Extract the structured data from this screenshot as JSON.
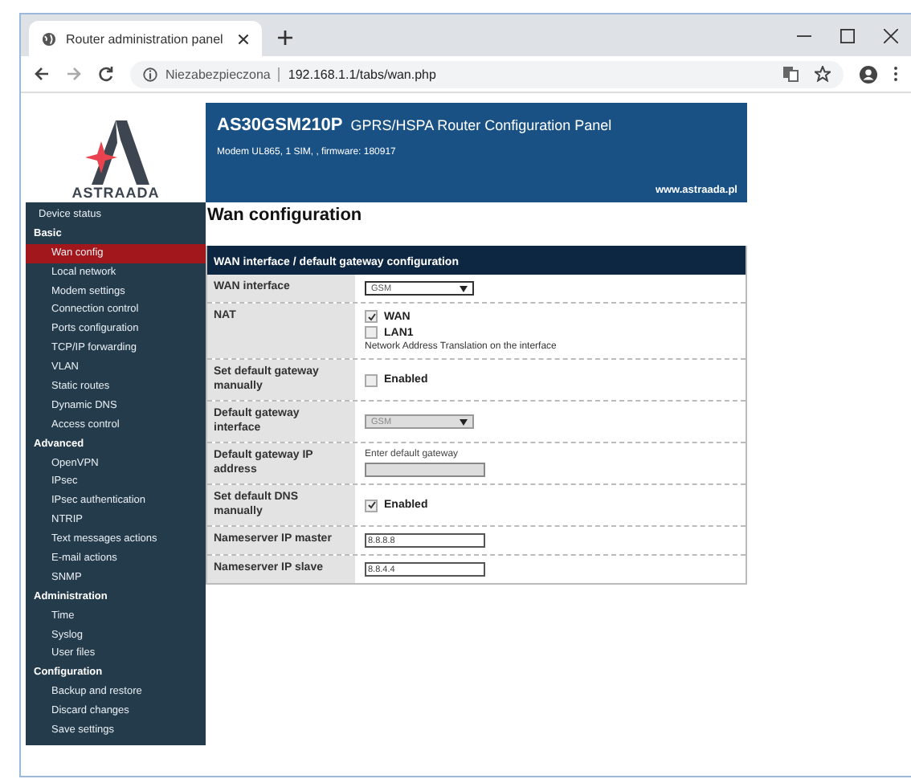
{
  "browser": {
    "tab_title": "Router administration panel",
    "security": "Niezabezpieczona",
    "url": "192.168.1.1/tabs/wan.php"
  },
  "logo": {
    "name": "ASTRAADA"
  },
  "header": {
    "model": "AS30GSM210P",
    "title": "GPRS/HSPA Router Configuration Panel",
    "subtitle": "Modem UL865, 1 SIM, , firmware: 180917",
    "website": "www.astraada.pl"
  },
  "sidebar": {
    "items": [
      {
        "label": "Device status",
        "kind": "item",
        "selected": false
      },
      {
        "label": "Basic",
        "kind": "group",
        "selected": false
      },
      {
        "label": "Wan config",
        "kind": "item",
        "selected": true
      },
      {
        "label": "Local network",
        "kind": "item",
        "selected": false
      },
      {
        "label": "Modem settings",
        "kind": "item",
        "selected": false
      },
      {
        "label": "Connection control",
        "kind": "item",
        "selected": false
      },
      {
        "label": "Ports configuration",
        "kind": "item",
        "selected": false
      },
      {
        "label": "TCP/IP forwarding",
        "kind": "item",
        "selected": false
      },
      {
        "label": "VLAN",
        "kind": "item",
        "selected": false
      },
      {
        "label": "Static routes",
        "kind": "item",
        "selected": false
      },
      {
        "label": "Dynamic DNS",
        "kind": "item",
        "selected": false
      },
      {
        "label": "Access control",
        "kind": "item",
        "selected": false
      },
      {
        "label": "Advanced",
        "kind": "group",
        "selected": false
      },
      {
        "label": "OpenVPN",
        "kind": "item",
        "selected": false
      },
      {
        "label": "IPsec",
        "kind": "item",
        "selected": false
      },
      {
        "label": "IPsec authentication",
        "kind": "item",
        "selected": false
      },
      {
        "label": "NTRIP",
        "kind": "item",
        "selected": false
      },
      {
        "label": "Text messages actions",
        "kind": "item",
        "selected": false
      },
      {
        "label": "E-mail actions",
        "kind": "item",
        "selected": false
      },
      {
        "label": "SNMP",
        "kind": "item",
        "selected": false
      },
      {
        "label": "Administration",
        "kind": "group",
        "selected": false
      },
      {
        "label": "Time",
        "kind": "item",
        "selected": false
      },
      {
        "label": "Syslog",
        "kind": "item",
        "selected": false
      },
      {
        "label": "User files",
        "kind": "item",
        "selected": false
      },
      {
        "label": "Configuration",
        "kind": "group",
        "selected": false
      },
      {
        "label": "Backup and restore",
        "kind": "item",
        "selected": false
      },
      {
        "label": "Discard changes",
        "kind": "item",
        "selected": false
      },
      {
        "label": "Save settings",
        "kind": "item",
        "selected": false
      }
    ]
  },
  "page_title": "Wan configuration",
  "panel": {
    "title": "WAN interface / default gateway configuration",
    "rows": [
      {
        "label": "WAN interface",
        "kind": "select",
        "value": "GSM",
        "disabled": false
      },
      {
        "label": "NAT",
        "kind": "checklist",
        "options": [
          {
            "label": "WAN",
            "checked": true
          },
          {
            "label": "LAN1",
            "checked": false
          }
        ],
        "note": "Network Address Translation on the interface"
      },
      {
        "label": "Set default gateway manually",
        "kind": "checkbox",
        "option": "Enabled",
        "checked": false
      },
      {
        "label": "Default gateway interface",
        "kind": "select",
        "value": "GSM",
        "disabled": true
      },
      {
        "label": "Default gateway IP address",
        "kind": "input",
        "hint": "Enter default gateway",
        "value": "",
        "disabled": true
      },
      {
        "label": "Set default DNS manually",
        "kind": "checkbox",
        "option": "Enabled",
        "checked": true
      },
      {
        "label": "Nameserver IP master",
        "kind": "input",
        "value": "8.8.8.8",
        "disabled": false
      },
      {
        "label": "Nameserver IP slave",
        "kind": "input",
        "value": "8.8.4.4",
        "disabled": false
      }
    ]
  }
}
